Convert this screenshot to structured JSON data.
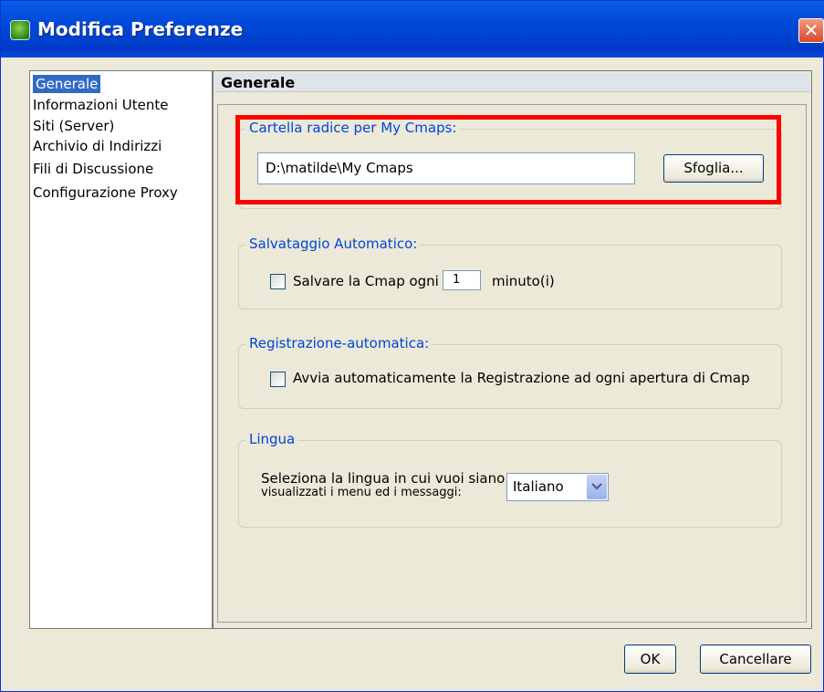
{
  "window": {
    "title": "Modifica Preferenze",
    "close_symbol": "✕",
    "app_icon": "cmap-icon"
  },
  "sidebar": {
    "items": [
      {
        "label": "Generale",
        "selected": true
      },
      {
        "label": "Informazioni Utente"
      },
      {
        "label": "Siti (Server)"
      },
      {
        "label": "Archivio di Indirizzi"
      },
      {
        "label": "Fili di Discussione"
      },
      {
        "label": "Configurazione Proxy"
      }
    ]
  },
  "panel": {
    "title": "Generale",
    "root_folder": {
      "legend": "Cartella radice per My Cmaps:",
      "path_value": "D:\\matilde\\My Cmaps",
      "browse_label": "Sfoglia..."
    },
    "autosave": {
      "legend": "Salvataggio Automatico:",
      "checkbox_label": "Salvare la Cmap ogni",
      "minutes_value": "1",
      "unit_label": "minuto(i)",
      "checked": false
    },
    "autologging": {
      "legend": "Registrazione-automatica:",
      "checkbox_label": "Avvia automaticamente la Registrazione ad ogni apertura di Cmap",
      "checked": false
    },
    "language": {
      "legend": "Lingua",
      "description_line1": "Seleziona la lingua in cui vuoi siano",
      "description_line2": "visualizzati i menu ed i messaggi:",
      "selected": "Italiano"
    }
  },
  "footer": {
    "ok_label": "OK",
    "cancel_label": "Cancellare"
  },
  "colors": {
    "accent": "#316ac5",
    "legend_text": "#0046d5",
    "highlight_box": "#ff0000",
    "titlebar": "#0049d8"
  }
}
